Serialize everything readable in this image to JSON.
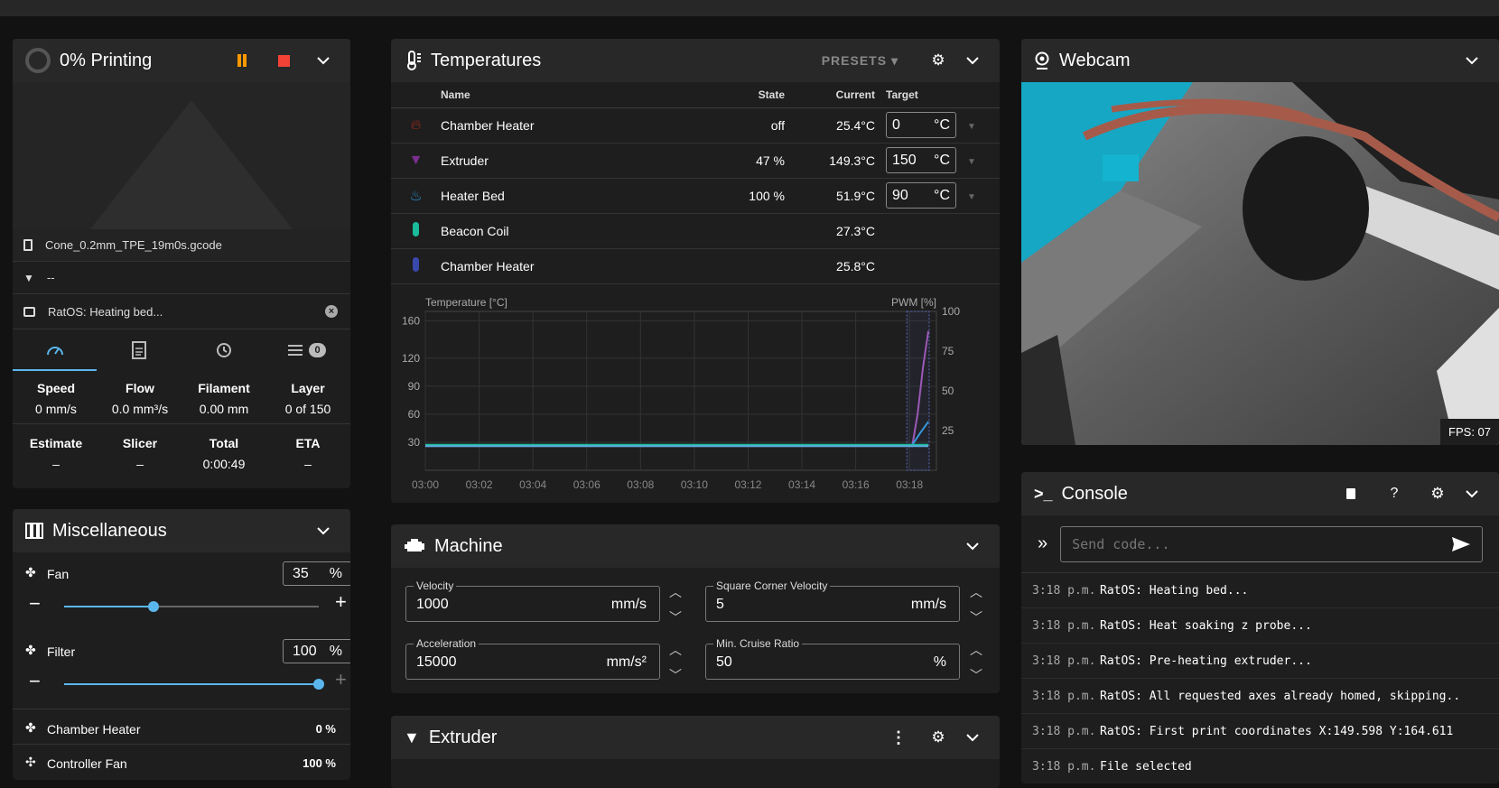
{
  "status": {
    "title": "0% Printing",
    "progress": 0,
    "filename": "Cone_0.2mm_TPE_19m0s.gcode",
    "filament_info": "--",
    "message": "RatOS: Heating bed...",
    "tabs": [
      {
        "icon": "speedometer-icon"
      },
      {
        "icon": "file-document-icon"
      },
      {
        "icon": "history-icon"
      },
      {
        "icon": "queue-icon",
        "badge": "0"
      }
    ],
    "stats_row1": [
      {
        "label": "Speed",
        "value": "0 mm/s"
      },
      {
        "label": "Flow",
        "value": "0.0 mm³/s"
      },
      {
        "label": "Filament",
        "value": "0.00 mm"
      },
      {
        "label": "Layer",
        "value": "0 of 150"
      }
    ],
    "stats_row2": [
      {
        "label": "Estimate",
        "value": "–"
      },
      {
        "label": "Slicer",
        "value": "–"
      },
      {
        "label": "Total",
        "value": "0:00:49"
      },
      {
        "label": "ETA",
        "value": "–"
      }
    ]
  },
  "misc": {
    "title": "Miscellaneous",
    "fan": {
      "label": "Fan",
      "value": "35",
      "unit": "%",
      "level": 35
    },
    "filter": {
      "label": "Filter",
      "value": "100",
      "unit": "%",
      "level": 100
    },
    "chamber_heater": {
      "label": "Chamber Heater",
      "value": "0 %"
    },
    "controller_fan": {
      "label": "Controller Fan",
      "value": "100 %"
    }
  },
  "temps": {
    "title": "Temperatures",
    "presets_label": "PRESETS",
    "headers": {
      "name": "Name",
      "state": "State",
      "current": "Current",
      "target": "Target"
    },
    "rows": [
      {
        "name": "Chamber Heater",
        "state": "off",
        "current": "25.4°C",
        "target": "0",
        "unit": "°C",
        "color": "#c0392b"
      },
      {
        "name": "Extruder",
        "state": "47 %",
        "current": "149.3°C",
        "target": "150",
        "unit": "°C",
        "color": "#8e44ad"
      },
      {
        "name": "Heater Bed",
        "state": "100 %",
        "current": "51.9°C",
        "target": "90",
        "unit": "°C",
        "color": "#2e86c1"
      },
      {
        "name": "Beacon Coil",
        "state": "",
        "current": "27.3°C",
        "color": "#1abc9c"
      },
      {
        "name": "Chamber Heater",
        "state": "",
        "current": "25.8°C",
        "color": "#3949ab"
      }
    ]
  },
  "chart_data": {
    "type": "line",
    "ylabel": "Temperature [°C]",
    "y2label": "PWM [%]",
    "yticks": [
      "160",
      "120",
      "90",
      "60",
      "30"
    ],
    "y2ticks": [
      "100",
      "75",
      "50",
      "25"
    ],
    "ylim": [
      0,
      170
    ],
    "y2lim": [
      0,
      100
    ],
    "xticks": [
      "03:00",
      "03:02",
      "03:04",
      "03:06",
      "03:08",
      "03:10",
      "03:12",
      "03:14",
      "03:16",
      "03:18"
    ],
    "xlim": [
      180,
      199
    ],
    "series": [
      {
        "color": "#9b59b6",
        "x": [
          180,
          198.1,
          198.3,
          198.5,
          198.7
        ],
        "y": [
          26,
          26,
          60,
          110,
          149
        ]
      },
      {
        "color": "#3498db",
        "x": [
          180,
          198.1,
          198.4,
          198.7
        ],
        "y": [
          27,
          27,
          40,
          52
        ]
      },
      {
        "color": "#1abc9c",
        "x": [
          180,
          198.7
        ],
        "y": [
          27.3,
          27.3
        ]
      },
      {
        "color": "#5dade2",
        "x": [
          180,
          198.7
        ],
        "y": [
          25.8,
          25.8
        ]
      }
    ]
  },
  "webcam": {
    "title": "Webcam",
    "fps": "FPS: 07"
  },
  "console": {
    "title": "Console",
    "placeholder": "Send code...",
    "lines": [
      {
        "time": "3:18 p.m.",
        "text": "RatOS: Heating bed..."
      },
      {
        "time": "3:18 p.m.",
        "text": "RatOS: Heat soaking z probe..."
      },
      {
        "time": "3:18 p.m.",
        "text": "RatOS: Pre-heating extruder..."
      },
      {
        "time": "3:18 p.m.",
        "text": "RatOS: All requested axes already homed, skipping.."
      },
      {
        "time": "3:18 p.m.",
        "text": "RatOS: First print coordinates X:149.598 Y:164.611"
      },
      {
        "time": "3:18 p.m.",
        "text": "File selected"
      }
    ]
  },
  "machine": {
    "title": "Machine",
    "velocity": {
      "label": "Velocity",
      "value": "1000",
      "unit": "mm/s"
    },
    "scv": {
      "label": "Square Corner Velocity",
      "value": "5",
      "unit": "mm/s"
    },
    "accel": {
      "label": "Acceleration",
      "value": "15000",
      "unit": "mm/s²"
    },
    "mcr": {
      "label": "Min. Cruise Ratio",
      "value": "50",
      "unit": "%"
    }
  },
  "extruder": {
    "title": "Extruder"
  }
}
